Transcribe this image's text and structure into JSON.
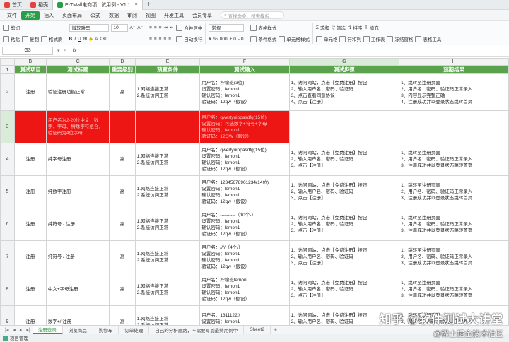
{
  "tabs": [
    {
      "label": "首页",
      "color": "#e8403a"
    },
    {
      "label": "稻壳",
      "color": "#e8403a"
    },
    {
      "label": "E-TMall电商项...试用例 - V1.1",
      "color": "#2a9d48"
    }
  ],
  "menu": {
    "file": "文件",
    "items": [
      "开始",
      "插入",
      "页面布局",
      "公式",
      "数据",
      "审阅",
      "视图",
      "开发工具",
      "会员专享"
    ],
    "search": "查找命令、搜索模板"
  },
  "ribbon": {
    "paste": "粘贴",
    "cut": "剪切",
    "copy": "复制",
    "format_painter": "格式刷",
    "font": "微软雅黑",
    "font_size": "10",
    "bold": "B",
    "italic": "I",
    "underline": "U",
    "merge": "合并居中",
    "wrap": "自动换行",
    "number_format": "常规",
    "cond_format": "条件格式",
    "table_style": "表格样式",
    "cell_style": "单元格样式",
    "sum": "求和",
    "filter": "筛选",
    "sort": "排序",
    "fill": "填充",
    "cell": "单元格",
    "row_col": "行和列",
    "worksheet": "工作表",
    "freeze": "冻结窗格",
    "table_tools": "表格工具"
  },
  "formula_bar": {
    "namebox": "G3",
    "fx": "fx"
  },
  "columns": [
    "B",
    "C",
    "D",
    "E",
    "F",
    "G",
    "H"
  ],
  "header_row": [
    "测试项目",
    "测试标题",
    "重要级别",
    "预置条件",
    "测试输入",
    "测试步骤",
    "预期结果"
  ],
  "rows": [
    {
      "num": "2",
      "item": "注册",
      "title": "验证注册功能正常",
      "level": "高",
      "pre": [
        "1.网络连接正常",
        "2.系统访问正常"
      ],
      "input": [
        "用户名：柠檬班(3位)",
        "设置密码：lemon1",
        "确认密码：lemon1",
        "验证码：12qw（假设）"
      ],
      "steps": [
        "1、访问网站，点击【免费注册】按钮",
        "2、输入用户名、密码、验证码",
        "3、点击查看同意协议",
        "4、点击【注册】"
      ],
      "expect": [
        "1、跳转至注册页面",
        "2、用户名、密码、验证码正常录入",
        "3、内容显示完整正确",
        "4、注册成功并以登录状态跳转首页"
      ]
    },
    {
      "num": "3",
      "red": true,
      "item": "",
      "title": "用户名为2-20位中文、数字、字母、特殊字符组合，验证码为4位字母",
      "level": "",
      "pre": [],
      "input": [
        "用户名：qwertyuiopasdfg(15位)",
        "设置密码：可选数字+符号+字母",
        "确认密码：lemon1",
        "验证码：12QW（假设）"
      ],
      "steps": [],
      "expect": []
    },
    {
      "num": "4",
      "item": "注册",
      "title": "纯字母注册",
      "level": "高",
      "pre": [
        "1.网络连接正常",
        "2.系统访问正常"
      ],
      "input": [
        "用户名：qwertyuiopasdfg(15位)",
        "设置密码：lemon1",
        "确认密码：lemon1",
        "验证码：12qw（假设）"
      ],
      "steps": [
        "1、访问网站，点击【免费注册】按钮",
        "2、输入用户名、密码、验证码",
        "3、点击【注册】"
      ],
      "expect": [
        "1、跳转至注册页面",
        "2、用户名、密码、验证码正常录入",
        "3、注册成功并以登录状态跳转首页"
      ]
    },
    {
      "num": "5",
      "item": "注册",
      "title": "纯数字注册",
      "level": "高",
      "pre": [
        "1.网络连接正常",
        "2.系统访问正常"
      ],
      "input": [
        "用户名：12345678901234(14位)",
        "设置密码：lemon1",
        "确认密码：lemon1",
        "验证码：12qw（假设）"
      ],
      "steps": [
        "1、访问网站，点击【免费注册】按钮",
        "2、输入用户名、密码、验证码",
        "3、点击【注册】"
      ],
      "expect": [
        "1、跳转至注册页面",
        "2、用户名、密码、验证码正常录入",
        "3、注册成功并以登录状态跳转首页"
      ]
    },
    {
      "num": "6",
      "item": "注册",
      "title": "纯符号 - 注册",
      "level": "高",
      "pre": [
        "1.网络连接正常",
        "2.系统访问正常"
      ],
      "input": [
        "用户名：----------（10个-）",
        "设置密码：lemon1",
        "确认密码：lemon1",
        "验证码：12qw（假设）"
      ],
      "steps": [
        "1、访问网站，点击【免费注册】按钮",
        "2、输入用户名、密码、验证码",
        "3、点击【注册】"
      ],
      "expect": [
        "1、跳转至注册页面",
        "2、用户名、密码、验证码正常录入",
        "3、注册成功并以登录状态跳转首页"
      ]
    },
    {
      "num": "7",
      "item": "注册",
      "title": "纯符号 / 注册",
      "level": "高",
      "pre": [
        "1.网络连接正常",
        "2.系统访问正常"
      ],
      "input": [
        "用户名：////（4个/）",
        "设置密码：lemon1",
        "确认密码：lemon1",
        "验证码：12qw（假设）"
      ],
      "steps": [
        "1、访问网站，点击【免费注册】按钮",
        "2、输入用户名、密码、验证码",
        "3、点击【注册】"
      ],
      "expect": [
        "1、跳转至注册页面",
        "2、用户名、密码、验证码正常录入",
        "3、注册成功并以登录状态跳转首页"
      ]
    },
    {
      "num": "8",
      "item": "注册",
      "title": "中文+字母注册",
      "level": "高",
      "pre": [
        "1.网络连接正常",
        "2.系统访问正常"
      ],
      "input": [
        "用户名：柠檬班lemon",
        "设置密码：lemon1",
        "确认密码：lemon1",
        "验证码：12qw（假设）"
      ],
      "steps": [
        "1、访问网站，点击【免费注册】按钮",
        "2、输入用户名、密码、验证码",
        "3、点击【注册】"
      ],
      "expect": [
        "1、跳转至注册页面",
        "2、用户名、密码、验证码正常录入",
        "3、注册成功并以登录状态跳转首页"
      ]
    },
    {
      "num": "9",
      "item": "注册",
      "title": "数字+/ 注册",
      "level": "高",
      "pre": [
        "1.网络连接正常",
        "2.系统访问正常"
      ],
      "input": [
        "用户名：1311122//",
        "设置密码：lemon1",
        "确认密码：lemon1"
      ],
      "steps": [
        "1、访问网站，点击【免费注册】按钮",
        "2、输入用户名、密码、验证码",
        "3、点击【注册】"
      ],
      "expect": [
        "1、跳转至注册页面",
        "2、用户名、密码、验证码正常录入",
        "3、注册成功并以登录状态跳转首页"
      ]
    }
  ],
  "sheets": [
    "注册登录",
    "浏览商品",
    "购物车",
    "订单处理",
    "自己的分析思路，不需要写到最终用例中",
    "Sheet2"
  ],
  "active_sheet": "注册登录",
  "status": {
    "label": "项目管理"
  },
  "watermark": {
    "line1": "知乎 @软件测试大讲堂",
    "line2": "@稀土掘金技术社区"
  }
}
